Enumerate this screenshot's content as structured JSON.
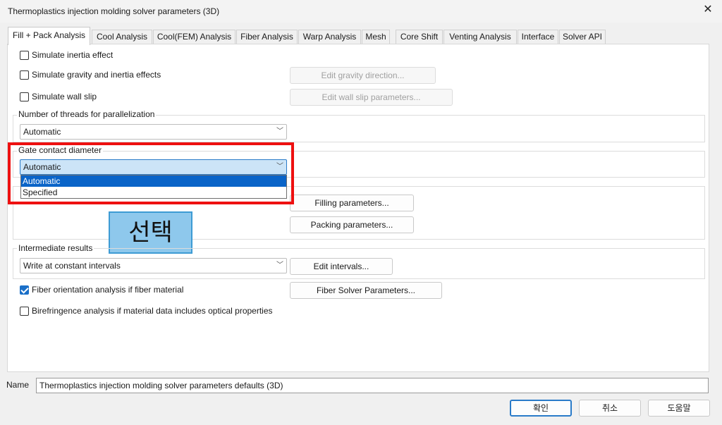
{
  "window": {
    "title": "Thermoplastics injection molding solver parameters (3D)",
    "close_glyph": "✕"
  },
  "tabs": [
    {
      "label": "Fill + Pack Analysis",
      "active": true
    },
    {
      "label": "Cool Analysis"
    },
    {
      "label": "Cool(FEM) Analysis"
    },
    {
      "label": "Fiber Analysis"
    },
    {
      "label": "Warp Analysis"
    },
    {
      "label": "Mesh"
    },
    {
      "label": "Core Shift"
    },
    {
      "label": "Venting Analysis"
    },
    {
      "label": "Interface"
    },
    {
      "label": "Solver API"
    }
  ],
  "options": {
    "inertia": {
      "label": "Simulate inertia effect",
      "checked": false
    },
    "gravity": {
      "label": "Simulate gravity and inertia effects",
      "checked": false
    },
    "wall_slip": {
      "label": "Simulate wall slip",
      "checked": false
    },
    "fiber_orientation": {
      "label": "Fiber orientation analysis if fiber material",
      "checked": true
    },
    "birefringence": {
      "label": "Birefringence analysis if material data includes optical properties",
      "checked": false
    }
  },
  "buttons": {
    "gravity_direction": "Edit gravity direction...",
    "wall_slip_params": "Edit wall slip parameters...",
    "filling_params": "Filling parameters...",
    "packing_params": "Packing parameters...",
    "edit_intervals": "Edit intervals...",
    "fiber_solver": "Fiber Solver Parameters..."
  },
  "threads": {
    "label": "Number of threads for parallelization",
    "value": "Automatic"
  },
  "gate": {
    "label": "Gate contact diameter",
    "value": "Automatic",
    "options": [
      "Automatic",
      "Specified"
    ],
    "selected_option": "Automatic"
  },
  "intermediate": {
    "label": "Intermediate results",
    "value": "Write at constant intervals"
  },
  "annotation": {
    "callout_text": "선택",
    "highlight_color": "#ee1010"
  },
  "name_field": {
    "label": "Name",
    "value": "Thermoplastics injection molding solver parameters defaults (3D)"
  },
  "dialog_buttons": {
    "ok": "확인",
    "cancel": "취소",
    "help": "도움말"
  },
  "icons": {
    "dropdown_arrow": "﹀",
    "close": "close-icon"
  }
}
